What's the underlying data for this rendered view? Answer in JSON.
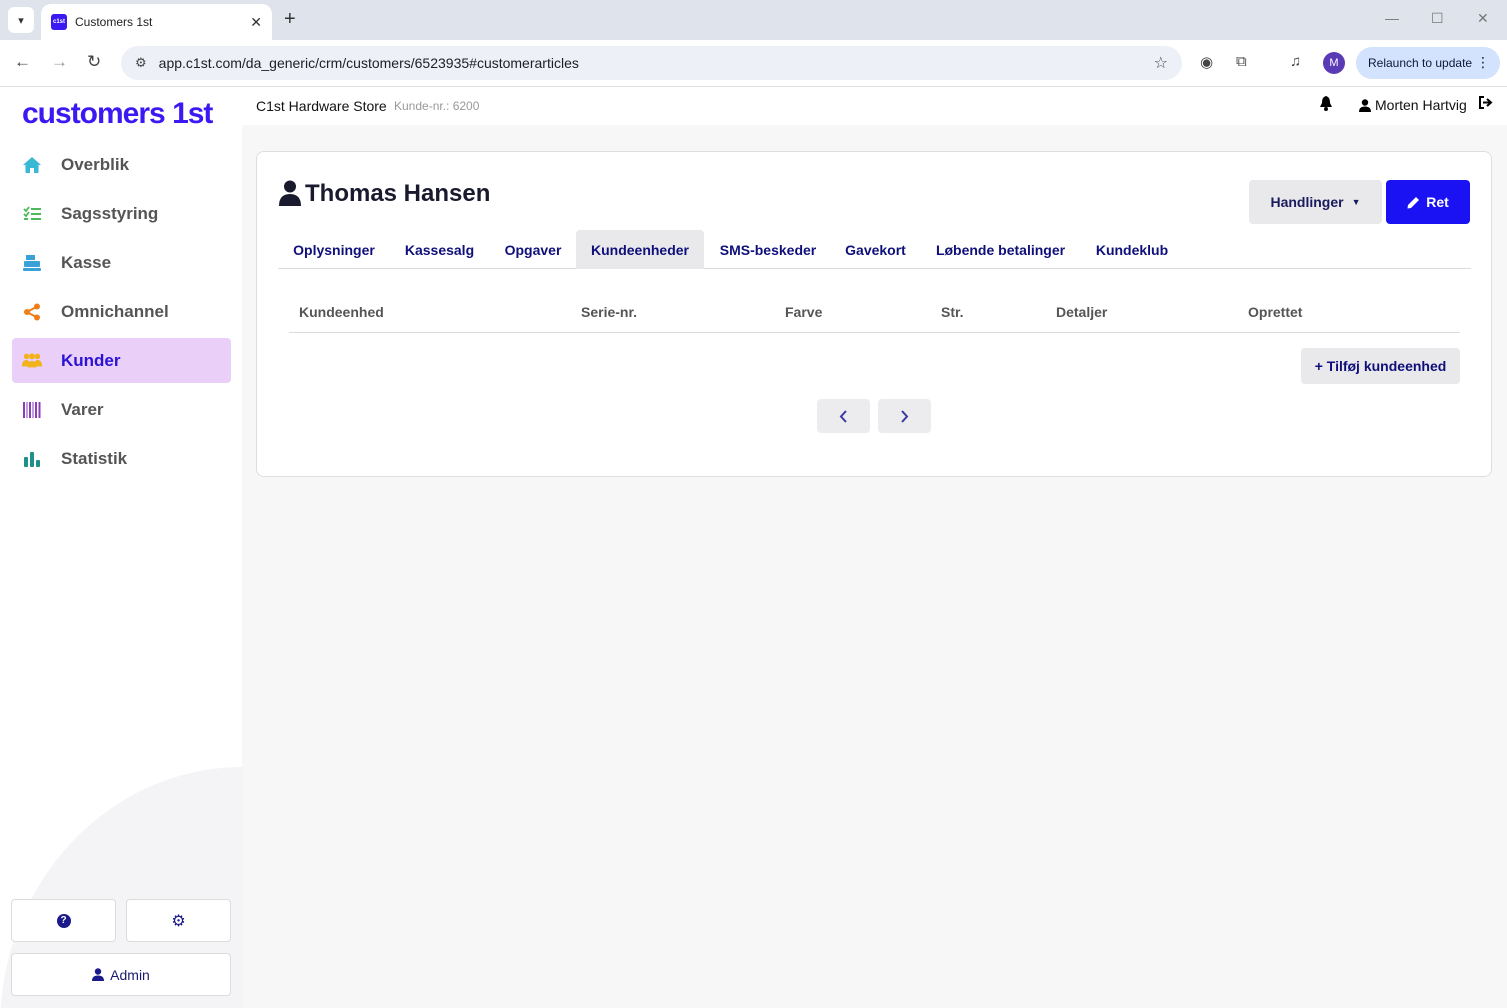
{
  "browser": {
    "tab_title": "Customers 1st",
    "tab_favicon": "c1st",
    "url": "app.c1st.com/da_generic/crm/customers/6523935#customerarticles",
    "relaunch_label": "Relaunch to update",
    "profile_initial": "M"
  },
  "brand": {
    "logo": "customers 1st",
    "accent": "#3a19f2"
  },
  "sidebar": {
    "items": [
      {
        "label": "Overblik",
        "icon": "home-icon",
        "color": "#3bb8d4"
      },
      {
        "label": "Sagsstyring",
        "icon": "checklist-icon",
        "color": "#4cba5a"
      },
      {
        "label": "Kasse",
        "icon": "register-icon",
        "color": "#3aa0d8"
      },
      {
        "label": "Omnichannel",
        "icon": "share-icon",
        "color": "#f07d17"
      },
      {
        "label": "Kunder",
        "icon": "users-icon",
        "color": "#f2b21a"
      },
      {
        "label": "Varer",
        "icon": "barcode-icon",
        "color": "#8a3fb8"
      },
      {
        "label": "Statistik",
        "icon": "chart-icon",
        "color": "#1f8f8a"
      }
    ],
    "active_item": "Kunder",
    "admin_label": "Admin"
  },
  "header": {
    "store_name": "C1st Hardware Store",
    "customer_no": "Kunde-nr.: 6200",
    "user_name": "Morten Hartvig"
  },
  "customer": {
    "name": "Thomas Hansen",
    "actions_label": "Handlinger",
    "edit_label": "Ret"
  },
  "tabs": [
    {
      "label": "Oplysninger"
    },
    {
      "label": "Kassesalg"
    },
    {
      "label": "Opgaver"
    },
    {
      "label": "Kundeenheder"
    },
    {
      "label": "SMS-beskeder"
    },
    {
      "label": "Gavekort"
    },
    {
      "label": "Løbende betalinger"
    },
    {
      "label": "Kundeklub"
    }
  ],
  "active_tab": "Kundeenheder",
  "table": {
    "columns": [
      "Kundeenhed",
      "Serie-nr.",
      "Farve",
      "Str.",
      "Detaljer",
      "Oprettet"
    ],
    "add_label": "+ Tilføj kundeenhed"
  }
}
